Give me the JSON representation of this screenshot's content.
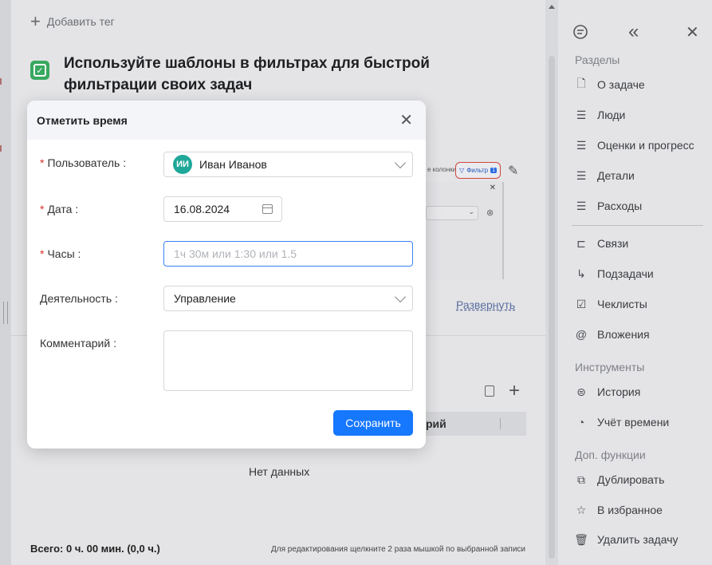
{
  "background": {
    "add_tag_label": "Добавить тег",
    "task_title": "Используйте шаблоны в фильтрах для быстрой фильтрации своих задач",
    "preview_columns_text": "е колонки",
    "preview_filter_label": "Фильтр",
    "preview_filter_count": "1",
    "expand_link": "Развернуть",
    "table_header_partial": "рий",
    "no_data": "Нет данных",
    "total": "Всего: 0 ч. 00 мин. (0,0 ч.)",
    "hint": "Для редактирования щелкните 2 раза мышкой по выбранной записи"
  },
  "sidebar": {
    "sections": [
      {
        "title": "Разделы"
      },
      {
        "title": "Инструменты"
      },
      {
        "title": "Доп. функции"
      }
    ],
    "items": [
      {
        "label": "О задаче",
        "icon": "document-icon"
      },
      {
        "label": "Люди",
        "icon": "lines-icon"
      },
      {
        "label": "Оценки и прогресс",
        "icon": "lines-icon"
      },
      {
        "label": "Детали",
        "icon": "lines-icon"
      },
      {
        "label": "Расходы",
        "icon": "lines-icon"
      },
      {
        "label": "Связи",
        "icon": "link-icon"
      },
      {
        "label": "Подзадачи",
        "icon": "subtask-icon"
      },
      {
        "label": "Чеклисты",
        "icon": "checkbox-icon"
      },
      {
        "label": "Вложения",
        "icon": "paperclip-icon"
      },
      {
        "label": "История",
        "icon": "history-icon"
      },
      {
        "label": "Учёт времени",
        "icon": "clock-pie-icon"
      },
      {
        "label": "Дублировать",
        "icon": "duplicate-icon"
      },
      {
        "label": "В избранное",
        "icon": "star-icon"
      },
      {
        "label": "Удалить задачу",
        "icon": "trash-icon"
      }
    ]
  },
  "modal": {
    "title": "Отметить время",
    "fields": {
      "user": {
        "label": "Пользователь",
        "value": "Иван Иванов",
        "avatar_initials": "ИИ",
        "avatar_color": "#1fa89a",
        "required": true
      },
      "date": {
        "label": "Дата",
        "value": "16.08.2024",
        "required": true
      },
      "hours": {
        "label": "Часы",
        "value": "",
        "placeholder": "1ч 30м или 1:30 или 1.5",
        "required": true
      },
      "activity": {
        "label": "Деятельность",
        "value": "Управление",
        "required": false
      },
      "comment": {
        "label": "Комментарий",
        "value": "",
        "required": false
      }
    },
    "save_label": "Сохранить"
  },
  "colors": {
    "primary": "#1677ff",
    "required_mark": "#d9322a",
    "focus_border": "#3b82f6"
  }
}
